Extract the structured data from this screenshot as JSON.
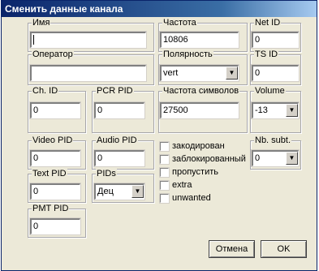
{
  "window": {
    "title": "Сменить данные канала"
  },
  "fields": {
    "name": {
      "label": "Имя",
      "value": ""
    },
    "frequency": {
      "label": "Частота",
      "value": "10806"
    },
    "net_id": {
      "label": "Net ID",
      "value": "0"
    },
    "operator": {
      "label": "Оператор",
      "value": ""
    },
    "polarity": {
      "label": "Полярность",
      "value": "vert"
    },
    "ts_id": {
      "label": "TS ID",
      "value": "0"
    },
    "ch_id": {
      "label": "Ch. ID",
      "value": "0"
    },
    "pcr_pid": {
      "label": "PCR PID",
      "value": "0"
    },
    "symbol_rate": {
      "label": "Частота символов",
      "value": "27500"
    },
    "volume": {
      "label": "Volume",
      "value": "-13"
    },
    "video_pid": {
      "label": "Video PID",
      "value": "0"
    },
    "audio_pid": {
      "label": "Audio PID",
      "value": "0"
    },
    "nb_subt": {
      "label": "Nb. subt.",
      "value": "0"
    },
    "text_pid": {
      "label": "Text PID",
      "value": "0"
    },
    "pids": {
      "label": "PIDs",
      "value": "Дец"
    },
    "pmt_pid": {
      "label": "PMT PID",
      "value": "0"
    }
  },
  "checkboxes": {
    "encrypted": {
      "label": "закодирован",
      "checked": false
    },
    "blocked": {
      "label": "заблокированный",
      "checked": false
    },
    "skip": {
      "label": "пропустить",
      "checked": false
    },
    "extra": {
      "label": "extra",
      "checked": false
    },
    "unwanted": {
      "label": "unwanted",
      "checked": false
    }
  },
  "buttons": {
    "cancel": "Отмена",
    "ok": "OK"
  },
  "icons": {
    "dropdown": "chevron-down-icon"
  }
}
